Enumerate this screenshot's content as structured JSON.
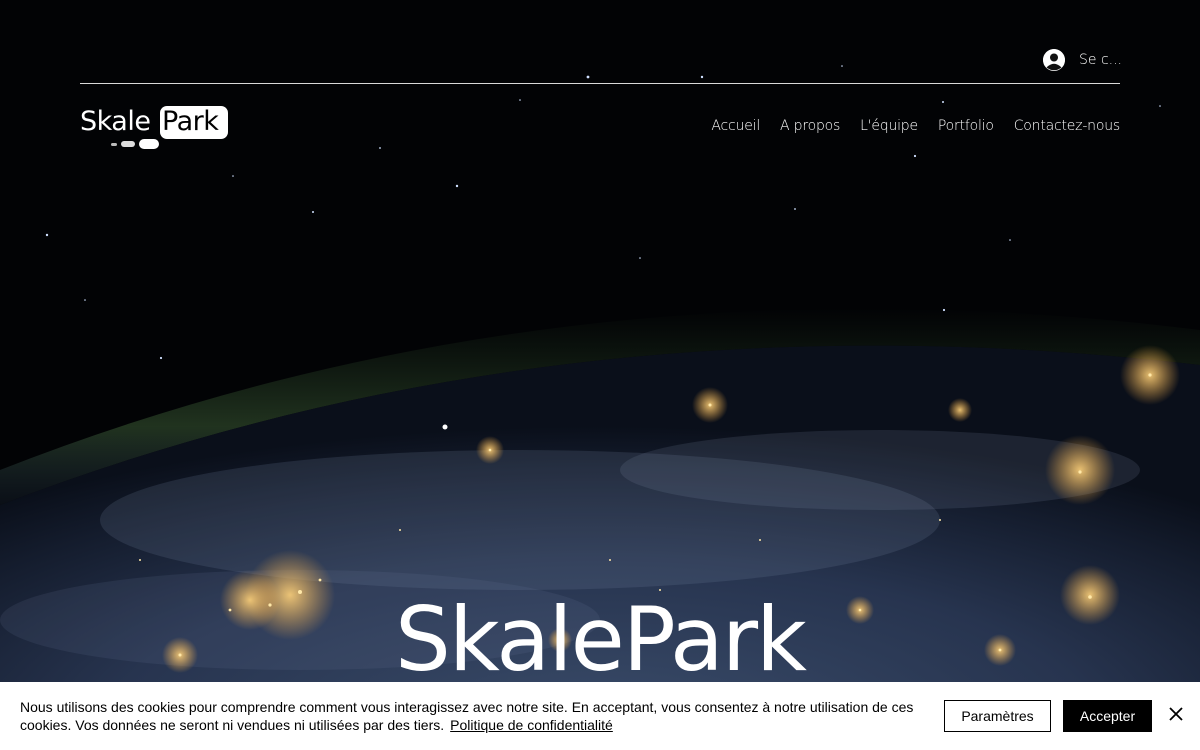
{
  "header": {
    "login_label": "Se c...",
    "logo_left": "Skale",
    "logo_right": "Park",
    "nav": [
      {
        "label": "Accueil"
      },
      {
        "label": "A propos"
      },
      {
        "label": "L'équipe"
      },
      {
        "label": "Portfolio"
      },
      {
        "label": "Contactez-nous"
      }
    ]
  },
  "hero": {
    "title": "SkalePark"
  },
  "cookie_banner": {
    "text": "Nous utilisons des cookies pour comprendre comment vous interagissez avec notre site. En acceptant, vous consentez à notre utilisation de ces cookies. Vos données ne seront ni vendues ni utilisées par des tiers.",
    "policy_link": "Politique de confidentialité",
    "settings_label": "Paramètres",
    "accept_label": "Accepter"
  },
  "icons": {
    "login": "avatar-icon",
    "close": "close-icon"
  }
}
